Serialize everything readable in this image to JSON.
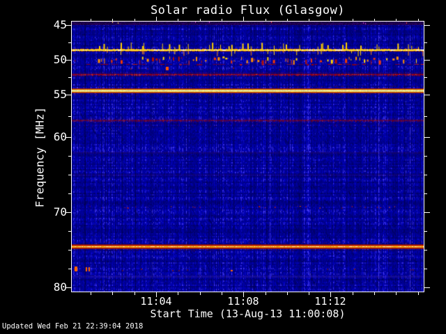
{
  "title": "Solar radio Flux (Glasgow)",
  "footer_text": "Updated Wed Feb 21 22:39:04 2018",
  "x_axis": {
    "label": "Start Time (13-Aug-13 11:00:08)",
    "major_ticks": [
      {
        "label": "11:04",
        "minute": 4
      },
      {
        "label": "11:08",
        "minute": 8
      },
      {
        "label": "11:12",
        "minute": 12
      }
    ],
    "minor_tick_minutes": [
      1,
      2,
      3,
      5,
      6,
      7,
      9,
      10,
      11,
      13,
      14,
      15,
      16
    ]
  },
  "y_axis": {
    "label": "Frequency [MHz]",
    "major_ticks": [
      {
        "label": "45",
        "value": 45
      },
      {
        "label": "50",
        "value": 50
      },
      {
        "label": "55",
        "value": 55
      },
      {
        "label": "60",
        "value": 60
      },
      {
        "label": "70",
        "value": 70
      },
      {
        "label": "80",
        "value": 80
      }
    ],
    "minor_tick_values": [
      47.5,
      52.5,
      57.5,
      62.5,
      65,
      67.5,
      72.5,
      75,
      77.5
    ]
  },
  "colors": {
    "background": "#000000",
    "axis": "#ffffff",
    "text": "#ffffff",
    "plot_base": "#000096"
  },
  "chart_data": {
    "type": "heatmap",
    "subtype": "solar-radio-spectrogram",
    "title": "Solar radio Flux (Glasgow)",
    "xlabel": "Start Time (13-Aug-13 11:00:08)",
    "ylabel": "Frequency [MHz]",
    "date": "13-Aug-13",
    "start_time": "11:00:08",
    "x_span_minutes": 16.13,
    "x_tick_labels": [
      "11:04",
      "11:08",
      "11:12"
    ],
    "y_tick_labels_mhz": [
      45,
      50,
      55,
      60,
      70,
      80
    ],
    "y_range_mhz": [
      44.5,
      80.6
    ],
    "grid": false,
    "legend": false,
    "background_noise": {
      "base_color": "#000096",
      "texture": "dark blue vertical striation noise"
    },
    "bands": [
      {
        "freq_mhz": 45.0,
        "style": "edge_band",
        "thickness_px": 5,
        "colors": [
          "#16003e",
          "#2c0062"
        ],
        "speck_colors": [
          "#cc44cc",
          "#8888ff",
          "#ffdd66",
          "#ff5544"
        ],
        "description": "dark purple top edge row with colored specks"
      },
      {
        "freq_mhz": 45.7,
        "style": "speckle_row",
        "color": "#991100",
        "bright_color": "#cc2200",
        "density": 0.3,
        "alpha": 0.45,
        "description": "very faint red speckle row"
      },
      {
        "freq_mhz": 48.6,
        "style": "spiky_line",
        "core_color": "#ffe83a",
        "hot_color": "#fff8d0",
        "edge_color": "#d06000",
        "spike_color": "#ffd000",
        "description": "strong continuous yellow RFI line with vertical spikes"
      },
      {
        "freq_mhz": 49.8,
        "style": "bursts",
        "palette": [
          "#ffd400",
          "#ff9000",
          "#f03800",
          "#b01000"
        ],
        "density": 0.55,
        "description": "dense intermittent burst dashes"
      },
      {
        "freq_mhz": 50.6,
        "style": "broken_red",
        "color": "#a00000",
        "bright_color": "#e02000",
        "density": 0.6,
        "description": "broken thin dark red line"
      },
      {
        "freq_mhz": 51.2,
        "style": "sparse_blobs",
        "color": "#ff5500",
        "items": [
          {
            "x_frac": 0.268,
            "w": 4,
            "h": 5
          }
        ],
        "dash_density": 0.02,
        "dash_color": "#992200",
        "description": "isolated orange blob"
      },
      {
        "freq_mhz": 52.1,
        "style": "fuzzy_red",
        "color": "#b00000",
        "bright_color": "#e83010",
        "alpha": 0.85,
        "fringe": false,
        "description": "fuzzy red RFI line"
      },
      {
        "freq_mhz": 54.35,
        "style": "bright_band",
        "colors": [
          "#a02000",
          "#ee7700",
          "#ffee44",
          "#fffbe0",
          "#ffee44",
          "#ee7700",
          "#a02000"
        ],
        "description": "very strong white-yellow RFI band"
      },
      {
        "freq_mhz": 58.0,
        "style": "fuzzy_red",
        "color": "#8b0000",
        "bright_color": "#c01800",
        "alpha": 0.7,
        "fringe": true,
        "description": "dark red mottled line with fringe below"
      },
      {
        "freq_mhz": 62.0,
        "style": "faint_row",
        "color": "#55103a",
        "alpha": 0.2,
        "thickness_px": 3,
        "description": "very faint dark band"
      },
      {
        "freq_mhz": 65.0,
        "style": "faint_row",
        "color": "#55103a",
        "alpha": 0.16,
        "thickness_px": 3,
        "description": "very faint dark band"
      },
      {
        "freq_mhz": 69.3,
        "style": "speckle_row",
        "color": "#c41e00",
        "bright_color": "#ff5500",
        "density": 0.55,
        "alpha": 0.9,
        "description": "row of small red dots"
      },
      {
        "freq_mhz": 74.5,
        "style": "orange_band",
        "colors": [
          "#7a1000",
          "#cc2200",
          "#ff6600",
          "#ffdf00",
          "#ff8800",
          "#cc2200",
          "#7a1000"
        ],
        "core_color": "#fff6b0",
        "description": "strong orange RFI band with bright yellow core"
      },
      {
        "freq_mhz": 77.6,
        "style": "sparse_blobs",
        "color": "#ff6600",
        "items": [
          {
            "x_frac": 0.008,
            "w": 4,
            "h": 7
          },
          {
            "x_frac": 0.04,
            "w": 2,
            "h": 6
          },
          {
            "x_frac": 0.048,
            "w": 2,
            "h": 6
          },
          {
            "x_frac": 0.452,
            "w": 3,
            "h": 2
          }
        ],
        "dash_density": 0.08,
        "dash_color": "#8a1a00",
        "description": "sparse orange blobs with dim red dashes"
      },
      {
        "freq_mhz": 78.5,
        "style": "faint_row",
        "color": "#5a35c0",
        "alpha": 0.28,
        "thickness_px": 3,
        "description": "faint purple band"
      }
    ]
  }
}
